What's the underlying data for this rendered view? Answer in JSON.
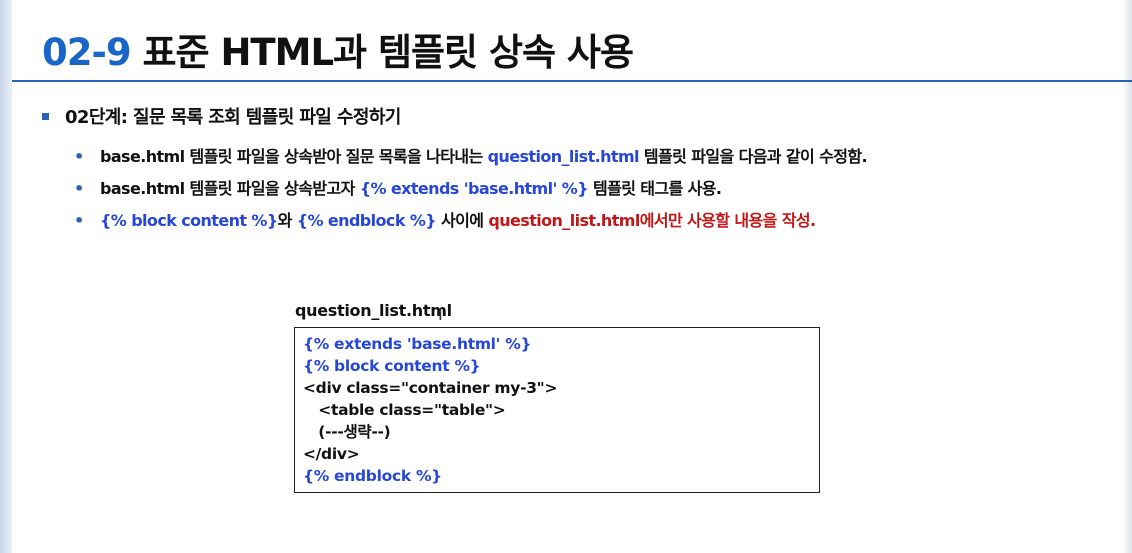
{
  "slide": {
    "title_number": "02-9",
    "title_text": "표준 HTML과 템플릿 상속 사용"
  },
  "step": {
    "label": "02단계: 질문 목록 조회 템플릿 파일 수정하기"
  },
  "bullets": [
    {
      "p1": "base.html 템플릿 파일을 상속받아 질문 목록을 나타내는 ",
      "p2": "question_list.html",
      "p3": " 템플릿 파일을 다음과 같이 수정함."
    },
    {
      "p1": "base.html 템플릿 파일을 상속받고자 ",
      "p2": "{% extends 'base.html' %}",
      "p3": " 템플릿 태그를 사용."
    },
    {
      "p1": "{% block content %}",
      "p2": "와 ",
      "p3": "{% endblock %}",
      "p4": " 사이에 ",
      "p5": "question_list.html에서만 사용할 내용을 작성."
    }
  ],
  "code": {
    "filename": "question_list.html",
    "lines": [
      "{% extends 'base.html' %}",
      "{% block content %}",
      "<div class=\"container my-3\">",
      "   <table class=\"table\">",
      "   (---생략--)",
      "</div>",
      "{% endblock %}"
    ]
  },
  "colors": {
    "accent_blue": "#1a66c8",
    "code_blue": "#2647d8",
    "highlight_red": "#c01818"
  }
}
